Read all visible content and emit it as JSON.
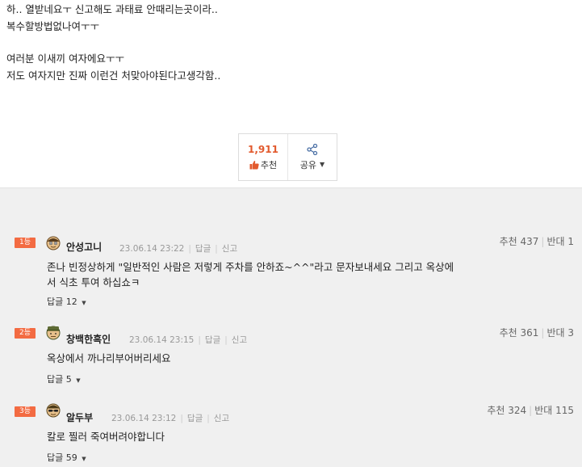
{
  "post": {
    "lines": [
      "하.. 열받네요ㅜ 신고해도 과태료 안때리는곳이라..",
      "복수할방법없나여ㅜㅜ",
      "여러분 이새끼 여자에요ㅜㅜ",
      "저도 여자지만 진짜 이런건 처맞아야된다고생각함.."
    ]
  },
  "vote": {
    "recommend_count": "1,911",
    "recommend_label": "추천",
    "share_label": "공유"
  },
  "comments": [
    {
      "rank": "1등",
      "nickname": "안성고니",
      "date": "23.06.14 23:22",
      "reply_link": "답글",
      "report_link": "신고",
      "recommend": "추천 437",
      "oppose": "반대 1",
      "text_lines": [
        "존나 빈정상하게 \"일반적인 사람은 저렇게 주차를 안하죠~^^\"라고 문자보내세요 그리고 옥상에",
        "서 식초 투여 하십쇼ㅋ"
      ],
      "reply_count": "답글 12"
    },
    {
      "rank": "2등",
      "nickname": "창백한흑인",
      "date": "23.06.14 23:15",
      "reply_link": "답글",
      "report_link": "신고",
      "recommend": "추천 361",
      "oppose": "반대 3",
      "text_lines": [
        "옥상에서 까나리부어버리세요"
      ],
      "reply_count": "답글 5"
    },
    {
      "rank": "3등",
      "nickname": "알두부",
      "date": "23.06.14 23:12",
      "reply_link": "답글",
      "report_link": "신고",
      "recommend": "추천 324",
      "oppose": "반대 115",
      "text_lines": [
        "칼로 찔러 죽여버려야합니다"
      ],
      "reply_count": "답글 59"
    }
  ],
  "icons": {
    "thumb": "thumbs-up-icon",
    "share": "share-icon",
    "caret": "caret-down-icon",
    "avatar": "avatar-icon"
  },
  "colors": {
    "accent": "#e25a2e",
    "rank_badge": "#f36b42"
  }
}
